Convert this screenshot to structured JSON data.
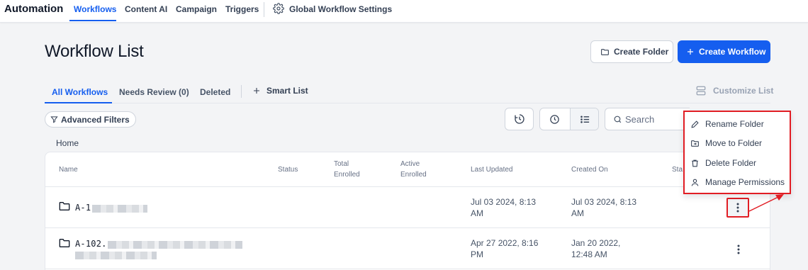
{
  "app": {
    "title": "Automation"
  },
  "top_nav": {
    "tabs": [
      {
        "label": "Workflows",
        "active": true
      },
      {
        "label": "Content AI"
      },
      {
        "label": "Campaign"
      },
      {
        "label": "Triggers"
      }
    ],
    "settings_label": "Global Workflow Settings"
  },
  "page": {
    "title": "Workflow List"
  },
  "actions": {
    "create_folder": "Create Folder",
    "create_workflow": "Create Workflow"
  },
  "sub_tabs": [
    {
      "label": "All Workflows",
      "active": true
    },
    {
      "label": "Needs Review (0)"
    },
    {
      "label": "Deleted"
    }
  ],
  "smart_list": "Smart List",
  "customize_list": "Customize List",
  "filters": {
    "advanced": "Advanced Filters"
  },
  "search": {
    "placeholder": "Search"
  },
  "breadcrumb": "Home",
  "table": {
    "columns": {
      "name": "Name",
      "status": "Status",
      "total_enrolled_1": "Total",
      "total_enrolled_2": "Enrolled",
      "active_enrolled_1": "Active",
      "active_enrolled_2": "Enrolled",
      "last_updated": "Last Updated",
      "created_on": "Created On",
      "stats_partial": "Sta"
    },
    "rows": [
      {
        "name": "A-1",
        "last_updated_1": "Jul 03 2024, 8:13",
        "last_updated_2": "AM",
        "created_1": "Jul 03 2024, 8:13",
        "created_2": "AM"
      },
      {
        "name": "A-102.",
        "last_updated_1": "Apr 27 2022, 8:16",
        "last_updated_2": "PM",
        "created_1": "Jan 20 2022,",
        "created_2": "12:48 AM"
      }
    ]
  },
  "context_menu": {
    "items": [
      {
        "label": "Rename Folder",
        "icon": "pencil-icon"
      },
      {
        "label": "Move to Folder",
        "icon": "folder-move-icon"
      },
      {
        "label": "Delete Folder",
        "icon": "trash-icon"
      },
      {
        "label": "Manage Permissions",
        "icon": "user-icon"
      }
    ]
  },
  "colors": {
    "primary": "#155eef",
    "highlight": "#e11d24"
  }
}
